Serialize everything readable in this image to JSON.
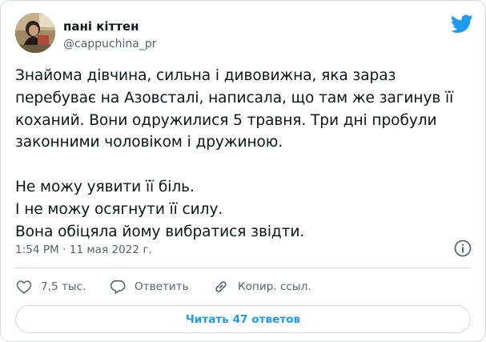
{
  "author": {
    "name": "пані кіттен",
    "handle": "@cappuchina_pr"
  },
  "tweet": {
    "lines": [
      "Знайома дівчина, сильна і дивовижна, яка зараз",
      "перебуває на Азовсталі, написала, що там же загинув її",
      "коханий. Вони одружилися 5 травня. Три дні пробули",
      "законними чоловіком і дружиною."
    ],
    "lines2": [
      "Не можу уявити її біль.",
      "І не можу осягнути її силу.",
      "Вона обіцяла йому вибратися звідти."
    ],
    "timestamp": "1:54 PM · 11 мая 2022 г."
  },
  "actions": {
    "likes": "7,5 тыс.",
    "reply": "Ответить",
    "copy_link": "Копир. ссыл."
  },
  "read_replies": "Читать 47 ответов",
  "colors": {
    "accent": "#1d9bf0",
    "secondary_text": "#536471",
    "border": "#cfd9de"
  },
  "icons": [
    "twitter-bird-icon",
    "info-icon",
    "heart-icon",
    "reply-bubble-icon",
    "link-icon"
  ]
}
